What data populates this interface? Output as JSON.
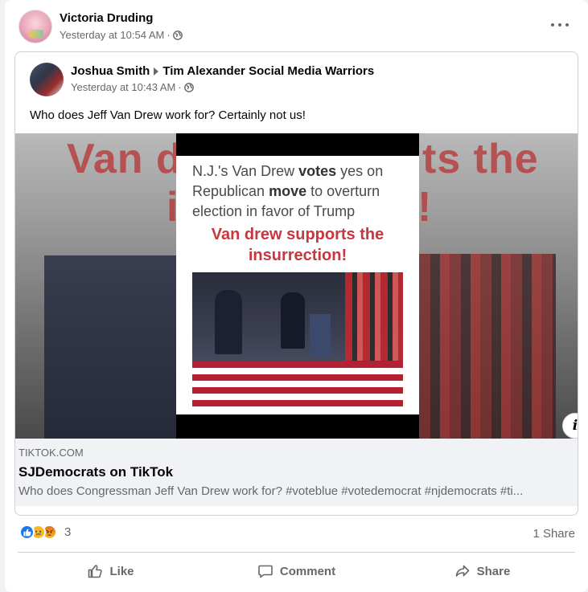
{
  "post": {
    "author": "Victoria Druding",
    "timestamp": "Yesterday at 10:54 AM",
    "separator": "·",
    "privacy_icon": "globe-icon",
    "more_icon": "more-options-icon"
  },
  "shared": {
    "author": "Joshua Smith",
    "target": "Tim Alexander Social Media Warriors",
    "timestamp": "Yesterday at 10:43 AM",
    "separator": "·",
    "text": "Who does Jeff Van Drew work for? Certainly not us!"
  },
  "media": {
    "bg_text_left": "Van d",
    "bg_text_right": "ts the",
    "bg_text_mid": "i",
    "bg_text_mid2": "!",
    "headline_part1": "N.J.'s Van Drew ",
    "headline_bold1": "votes",
    "headline_part2": " yes on Republican ",
    "headline_bold2": "move",
    "headline_part3": " to overturn election in favor of Trump",
    "red_caption": "Van drew supports the insurrection!",
    "info_label": "i"
  },
  "link": {
    "domain": "TIKTOK.COM",
    "title": "SJDemocrats on TikTok",
    "description": "Who does Congressman Jeff Van Drew work for? #voteblue #votedemocrat #njdemocrats #ti..."
  },
  "stats": {
    "reaction_count": "3",
    "shares": "1 Share",
    "reactions": [
      "like-reaction-icon",
      "sad-reaction-icon",
      "angry-reaction-icon"
    ]
  },
  "actions": {
    "like": "Like",
    "comment": "Comment",
    "share": "Share"
  },
  "colors": {
    "accent": "#1877f2",
    "muted_text": "#65676b",
    "red_caption": "#c8363f"
  }
}
